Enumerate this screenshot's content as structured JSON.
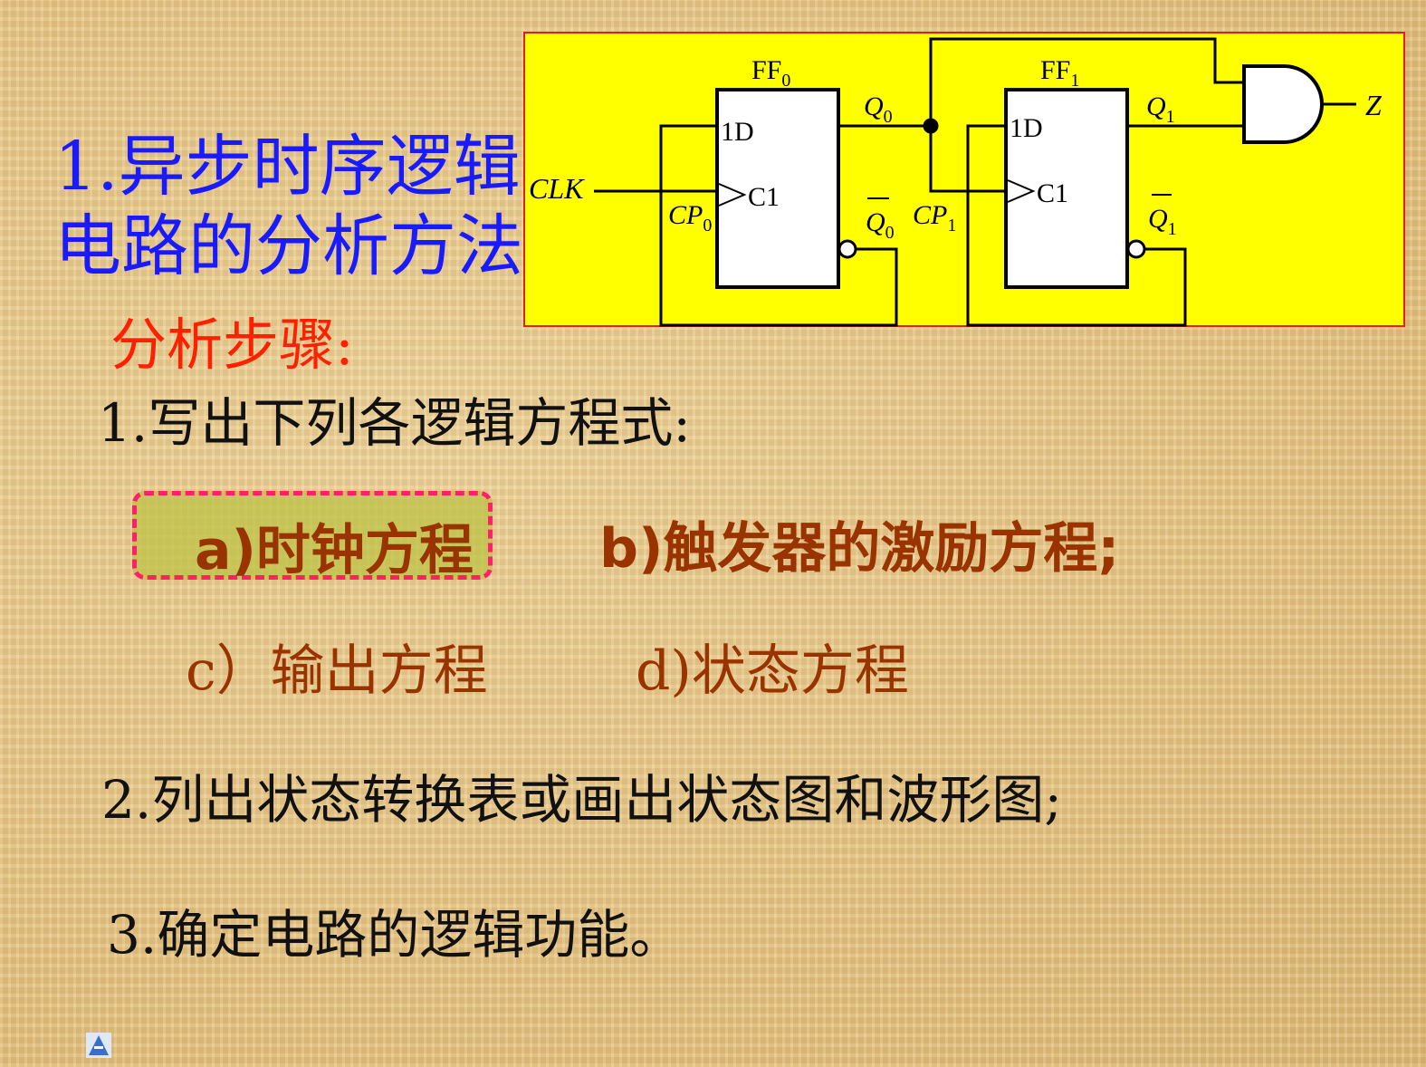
{
  "slide": {
    "title_line1": "1.异步时序逻辑",
    "title_line2": "电路的分析方法",
    "steps_heading": "分析步骤:",
    "step1": "1.写出下列各逻辑方程式:",
    "sub_a": "a)时钟方程",
    "sub_b": "b)触发器的激励方程;",
    "sub_c": "c）输出方程",
    "sub_d": "d)状态方程",
    "step2": "2.列出状态转换表或画出状态图和波形图;",
    "step3": "3.确定电路的逻辑功能。"
  },
  "circuit": {
    "ff0_label": "FF",
    "ff0_sub": "0",
    "ff1_label": "FF",
    "ff1_sub": "1",
    "d_input": "1D",
    "clk_input": "C1",
    "clk_label": "CLK",
    "cp_label": "CP",
    "cp0_sub": "0",
    "cp1_sub": "1",
    "q_label": "Q",
    "q0_sub": "0",
    "q1_sub": "1",
    "z_label": "Z"
  },
  "colors": {
    "title": "#1a1aff",
    "steps_heading": "#ff2000",
    "sub_items": "#993300",
    "highlight_border": "#ff1f6b",
    "circuit_bg": "#ffff00"
  },
  "icons": [
    "presentation-logo-icon"
  ]
}
